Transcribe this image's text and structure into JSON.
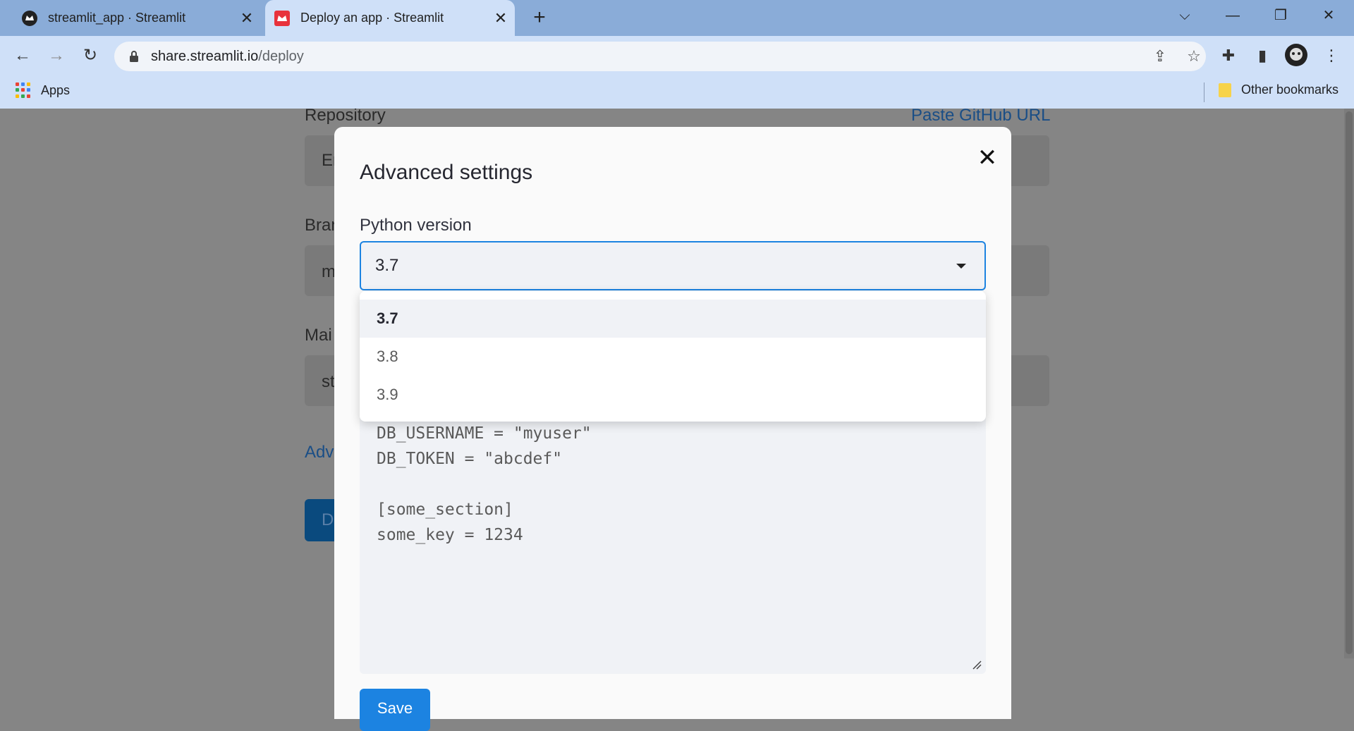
{
  "browser": {
    "tabs": [
      {
        "title": "streamlit_app · Streamlit"
      },
      {
        "title": "Deploy an app · Streamlit"
      }
    ],
    "url_host": "share.streamlit.io",
    "url_path": "/deploy",
    "bookmarks": {
      "apps": "Apps",
      "other": "Other bookmarks"
    }
  },
  "background_form": {
    "repository_label": "Repository",
    "paste_link": "Paste GitHub URL",
    "repo_value_partial": "Er",
    "branch_label_partial": "Bran",
    "branch_value_partial": "m",
    "main_label_partial": "Mai",
    "main_value_partial": "st",
    "advanced_link_partial": "Adv",
    "deploy_button_partial": "D"
  },
  "modal": {
    "title": "Advanced settings",
    "python_label": "Python version",
    "python_selected": "3.7",
    "python_options": [
      "3.7",
      "3.8",
      "3.9"
    ],
    "secrets_lines": [
      "DB_USERNAME = \"myuser\"",
      "DB_TOKEN = \"abcdef\"",
      "",
      "[some_section]",
      "some_key = 1234"
    ],
    "save_label": "Save"
  }
}
